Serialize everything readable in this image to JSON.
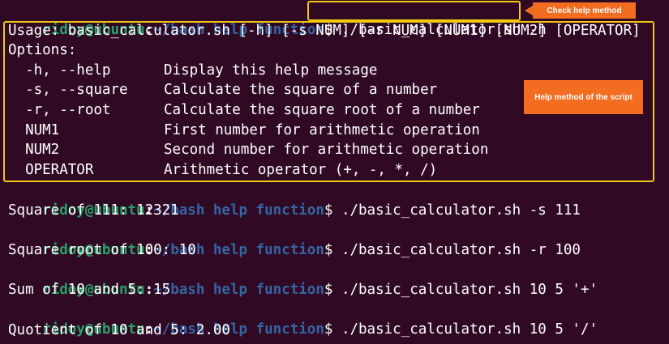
{
  "prompt": {
    "user": "ridoy@ubuntu",
    "sep": ":",
    "path": "~/bash help function",
    "dollar": "$"
  },
  "commands": [
    " ./basic_calculator.sh -h",
    " ./basic_calculator.sh -s 111",
    " ./basic_calculator.sh -r 100",
    " ./basic_calculator.sh 10 5 '+'",
    " ./basic_calculator.sh 10 5 '/'"
  ],
  "help": {
    "usage": "Usage: basic_calculator.sh [-h] [-s NUM] [-r NUM] [NUM1] [NUM2] [OPERATOR]",
    "options_title": "Options:",
    "options": [
      {
        "flag": "  -h, --help",
        "desc": "Display this help message"
      },
      {
        "flag": "  -s, --square",
        "desc": "Calculate the square of a number"
      },
      {
        "flag": "  -r, --root",
        "desc": "Calculate the square root of a number"
      },
      {
        "flag": "  NUM1",
        "desc": "First number for arithmetic operation"
      },
      {
        "flag": "  NUM2",
        "desc": "Second number for arithmetic operation"
      },
      {
        "flag": "  OPERATOR",
        "desc": "Arithmetic operator (+, -, *, /)"
      }
    ]
  },
  "outputs": [
    "Square of 111: 12321",
    "Square root of 100: 10",
    "Sum of 10 and 5: 15",
    "Quotient of 10 and 5: 2.00"
  ],
  "annotations": {
    "check_help": "Check help method",
    "help_script": "Help method of the script"
  },
  "colors": {
    "background": "#300a24",
    "user": "#26a269",
    "path": "#3465a4",
    "highlight_border": "#f2c811",
    "callout": "#f36d21"
  }
}
